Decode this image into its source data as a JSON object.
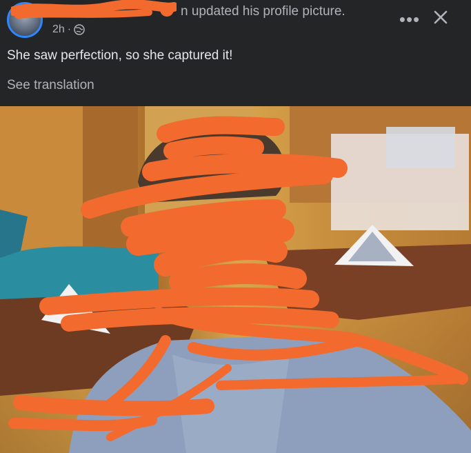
{
  "post": {
    "meta_text": "n updated his profile picture.",
    "time": "2h",
    "caption": "She saw perfection, so she captured it!",
    "see_translation": "See translation"
  },
  "actions": {
    "more_icon": "more-horizontal-icon",
    "close_icon": "close-icon"
  },
  "icons": {
    "globe": "globe-icon"
  },
  "colors": {
    "background": "#242526",
    "primary_text": "#e4e6eb",
    "secondary_text": "#b0b3b8",
    "avatar_ring": "#2d88ff",
    "redaction": "#f26a2e"
  }
}
